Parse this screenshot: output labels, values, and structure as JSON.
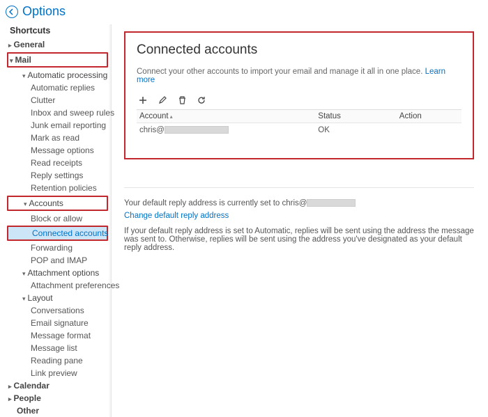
{
  "header": {
    "title": "Options"
  },
  "sidebar": {
    "shortcuts": "Shortcuts",
    "general": "General",
    "mail": "Mail",
    "autoproc": "Automatic processing",
    "autoproc_items": [
      "Automatic replies",
      "Clutter",
      "Inbox and sweep rules",
      "Junk email reporting",
      "Mark as read",
      "Message options",
      "Read receipts",
      "Reply settings",
      "Retention policies"
    ],
    "accounts": "Accounts",
    "accounts_items": [
      "Block or allow",
      "Connected accounts",
      "Forwarding",
      "POP and IMAP"
    ],
    "attach": "Attachment options",
    "attach_items": [
      "Attachment preferences"
    ],
    "layout": "Layout",
    "layout_items": [
      "Conversations",
      "Email signature",
      "Message format",
      "Message list",
      "Reading pane",
      "Link preview"
    ],
    "calendar": "Calendar",
    "people": "People",
    "other": "Other"
  },
  "panel": {
    "title": "Connected accounts",
    "desc": "Connect your other accounts to import your email and manage it all in one place. ",
    "learn": "Learn more",
    "cols": {
      "account": "Account",
      "status": "Status",
      "action": "Action"
    },
    "row": {
      "account_prefix": "chris@",
      "status": "OK"
    }
  },
  "reply": {
    "line_pre": "Your default reply address is currently set to chris@",
    "change": "Change default reply address",
    "note": "If your default reply address is set to Automatic, replies will be sent using the address the message was sent to. Otherwise, replies will be sent using the address you've designated as your default reply address."
  }
}
